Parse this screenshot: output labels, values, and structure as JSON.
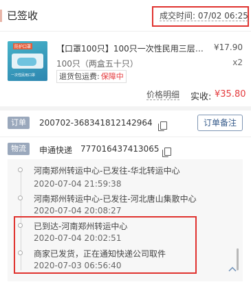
{
  "header": {
    "status": "已签收",
    "deal_time": "成交时间: 07/02 06:25"
  },
  "product": {
    "image_text_top": "防护口罩",
    "image_text_bottom": "一次性民用口罩",
    "title": "【口罩100只】100只一次性民用三层防...",
    "price": "¥17.90",
    "spec": "100只（两盒五十只）",
    "qty": "x2",
    "return_label": "退货包运费:",
    "return_value": "保障中",
    "price_detail": "价格明细",
    "paid_label": "实收:",
    "paid_value": "¥35.80"
  },
  "order": {
    "tag": "订单",
    "number": "200702-368341812142964",
    "remark_button": "订单备注"
  },
  "logistics": {
    "tag": "物流",
    "carrier": "申通快递",
    "tracking": "777016437413065",
    "events": [
      {
        "text": "河南郑州转运中心-已发往-华北转运中心",
        "time": "2020-07-04 21:59:38"
      },
      {
        "text": "河南郑州转运中心-已发往-河北唐山集散中心",
        "time": "2020-07-04 20:08:27"
      },
      {
        "text": "已到达-河南郑州转运中心",
        "time": "2020-07-04 20:02:51"
      },
      {
        "text": "商家已发货，正在通知快递公司取件",
        "time": "2020-07-03 06:56:40"
      }
    ]
  },
  "colors": {
    "accent_red": "#e0322e",
    "price_red": "#e4393c",
    "tag_gray": "#9aa8bc",
    "link_blue": "#355a8a"
  },
  "icons": [
    "collapse-bar-icon",
    "copy-icon",
    "chevron-up-icon",
    "timeline-dot-icon"
  ]
}
